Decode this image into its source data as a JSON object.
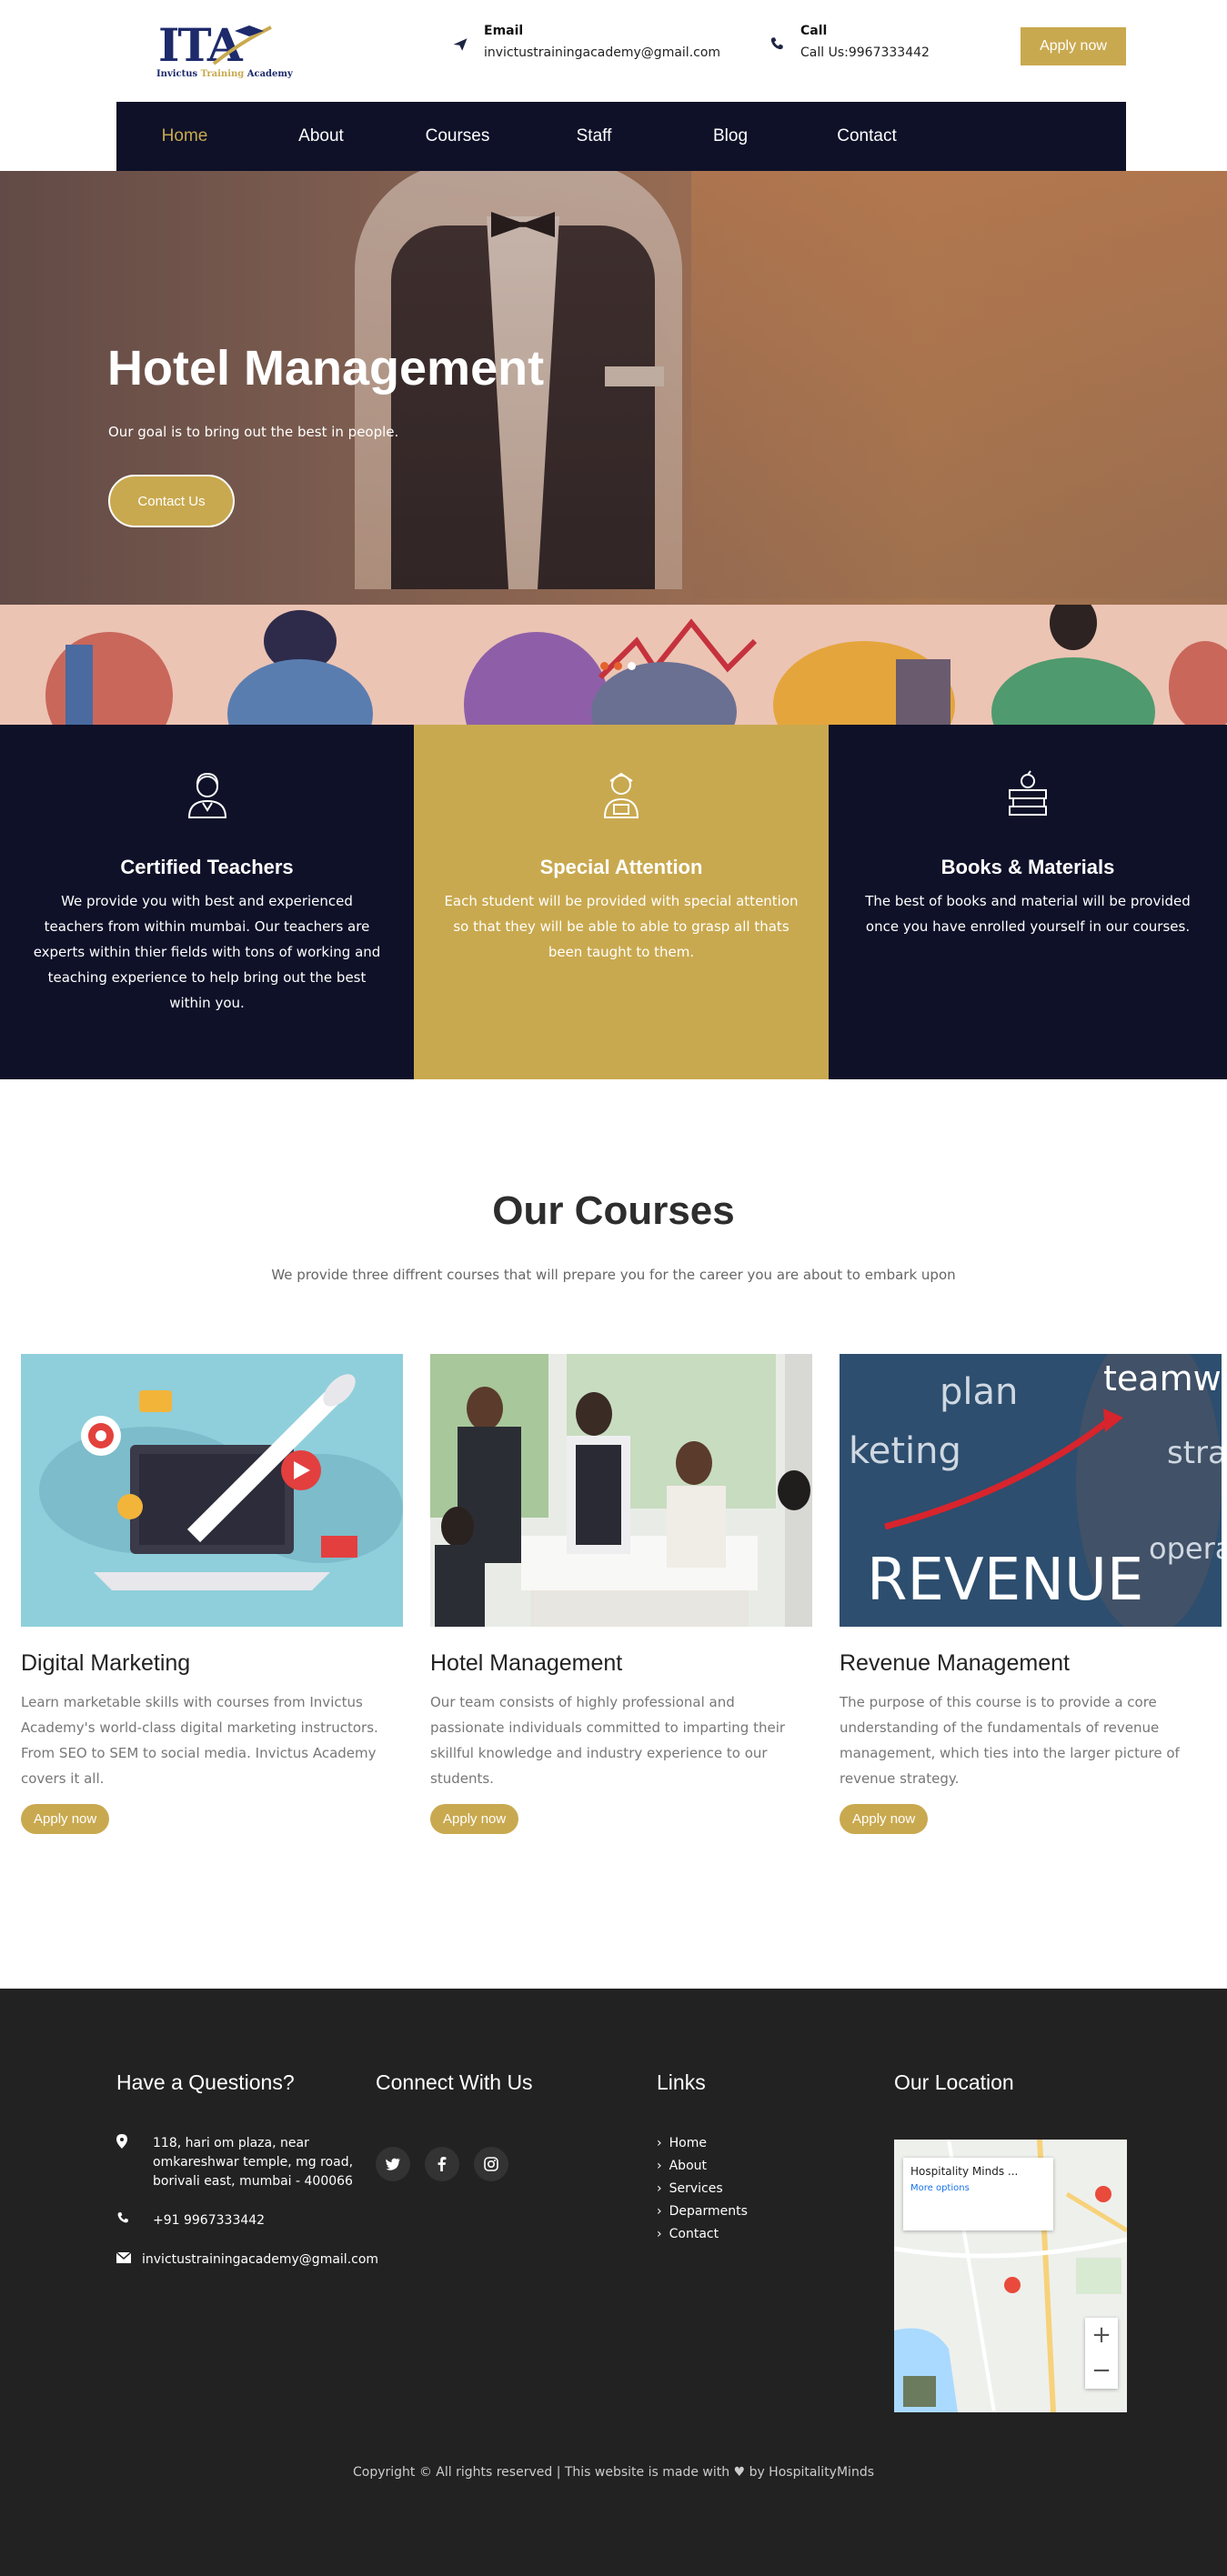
{
  "header": {
    "email_label": "Email",
    "email_value": "invictustrainingacademy@gmail.com",
    "call_label": "Call",
    "call_value": "Call Us:9967333442",
    "apply_label": "Apply now",
    "logo_mark": "ITA",
    "logo_sub_a": "Invictus",
    "logo_sub_b": "Training",
    "logo_sub_c": "Academy"
  },
  "nav": {
    "items": [
      "Home",
      "About",
      "Courses",
      "Staff",
      "Blog",
      "Contact"
    ],
    "active": "Home"
  },
  "hero": {
    "title": "Hotel Management",
    "subtitle": "Our goal is to bring out the best in people.",
    "cta": "Contact Us",
    "slides": 3,
    "current_slide": 3
  },
  "features": [
    {
      "title": "Certified Teachers",
      "text": "We provide you with best and experienced teachers from within mumbai. Our teachers are experts within thier fields with tons of working and teaching experience to help bring out the best within you.",
      "icon": "teacher-icon"
    },
    {
      "title": "Special Attention",
      "text": "Each student will be provided with special attention so that they will be able to able to grasp all thats been taught to them.",
      "icon": "student-icon"
    },
    {
      "title": "Books & Materials",
      "text": "The best of books and material will be provided once you have enrolled yourself in our courses.",
      "icon": "books-icon"
    }
  ],
  "courses": {
    "heading": "Our Courses",
    "lead": "We provide three diffrent courses that will prepare you for the career you are about to embark upon",
    "items": [
      {
        "title": "Digital Marketing",
        "text": "Learn marketable skills with courses from Invictus Academy's world-class digital marketing instructors. From SEO to SEM to social media. Invictus Academy covers it all.",
        "button": "Apply now"
      },
      {
        "title": "Hotel Management",
        "text": "Our team consists of highly professional and passionate individuals committed to imparting their skillful knowledge and industry experience to our students.",
        "button": "Apply now"
      },
      {
        "title": "Revenue Management",
        "text": "The purpose of this course is to provide a core understanding of the fundamentals of revenue management, which ties into the larger picture of revenue strategy.",
        "button": "Apply now"
      }
    ],
    "revenue_word": "REVENUE",
    "chalk_words": [
      "plan",
      "teamw",
      "keting",
      "strat",
      "opera"
    ]
  },
  "footer": {
    "questions_heading": "Have a Questions?",
    "connect_heading": "Connect With Us",
    "links_heading": "Links",
    "location_heading": "Our Location",
    "address": "118, hari om plaza, near omkareshwar temple, mg road, borivali east, mumbai - 400066",
    "phone": "+91 9967333442",
    "email": "invictustrainingacademy@gmail.com",
    "links": [
      "Home",
      "About",
      "Services",
      "Deparments",
      "Contact"
    ],
    "map_place": "Hospitality Minds ...",
    "map_more": "More options",
    "copyright": "Copyright © All rights reserved | This website is made with ♥ by HospitalityMinds"
  },
  "colors": {
    "navy": "#0e1128",
    "gold": "#c9a94f",
    "footer": "#222222"
  }
}
